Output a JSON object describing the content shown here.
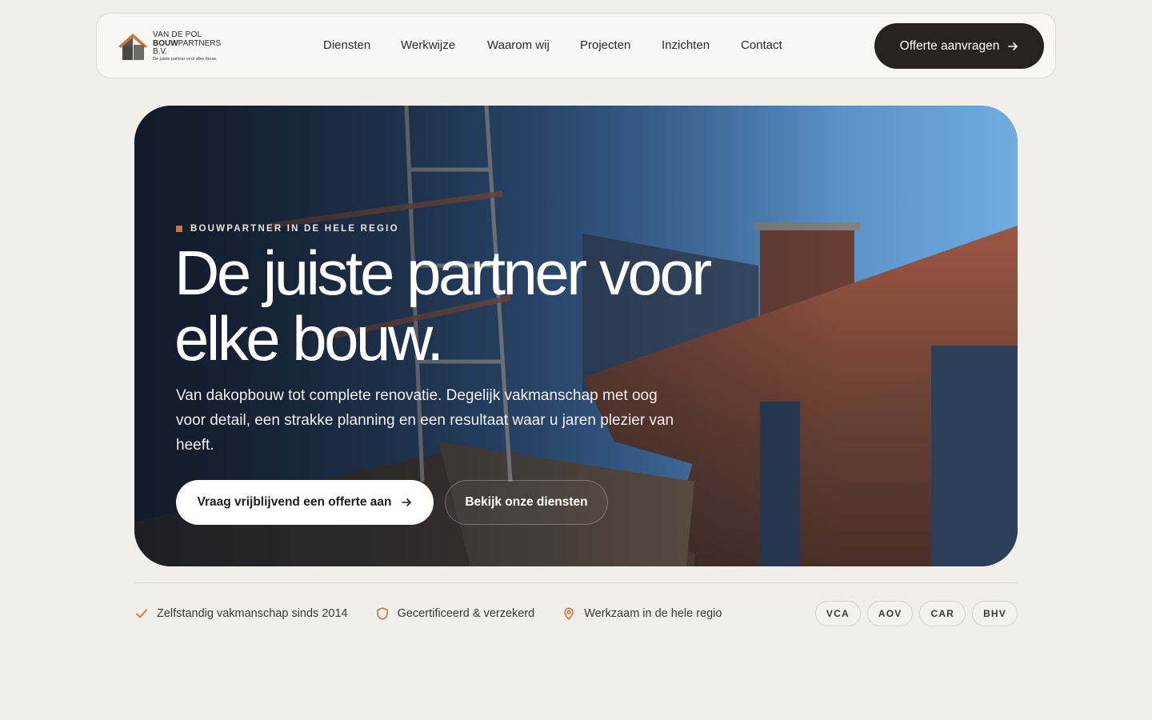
{
  "header": {
    "logo": {
      "line1": "VAN DE POL",
      "line2_bold": "BOUW",
      "line2_rest": "PARTNERS B.V.",
      "tagline": "De juiste partner voor elke bouw."
    },
    "nav": [
      {
        "label": "Diensten"
      },
      {
        "label": "Werkwijze"
      },
      {
        "label": "Waarom wij"
      },
      {
        "label": "Projecten"
      },
      {
        "label": "Inzichten"
      },
      {
        "label": "Contact"
      }
    ],
    "cta_label": "Offerte aanvragen"
  },
  "hero": {
    "eyebrow": "BOUWPARTNER IN DE HELE REGIO",
    "title": "De juiste partner voor elke bouw.",
    "subtitle": "Van dakopbouw tot complete renovatie. Degelijk vakmanschap met oog voor detail, een strakke planning en een resultaat waar u jaren plezier van heeft.",
    "primary_button": "Vraag vrijblijvend een offerte aan",
    "secondary_button": "Bekijk onze diensten"
  },
  "trust": {
    "items": [
      {
        "icon": "check-icon",
        "label": "Zelfstandig vakmanschap sinds 2014"
      },
      {
        "icon": "shield-icon",
        "label": "Gecertificeerd & verzekerd"
      },
      {
        "icon": "location-pin-icon",
        "label": "Werkzaam in de hele regio"
      }
    ],
    "badges": [
      "VCA",
      "AOV",
      "CAR",
      "BHV"
    ]
  },
  "colors": {
    "accent": "#c9773f",
    "dark": "#28231f",
    "background": "#f1efea"
  }
}
